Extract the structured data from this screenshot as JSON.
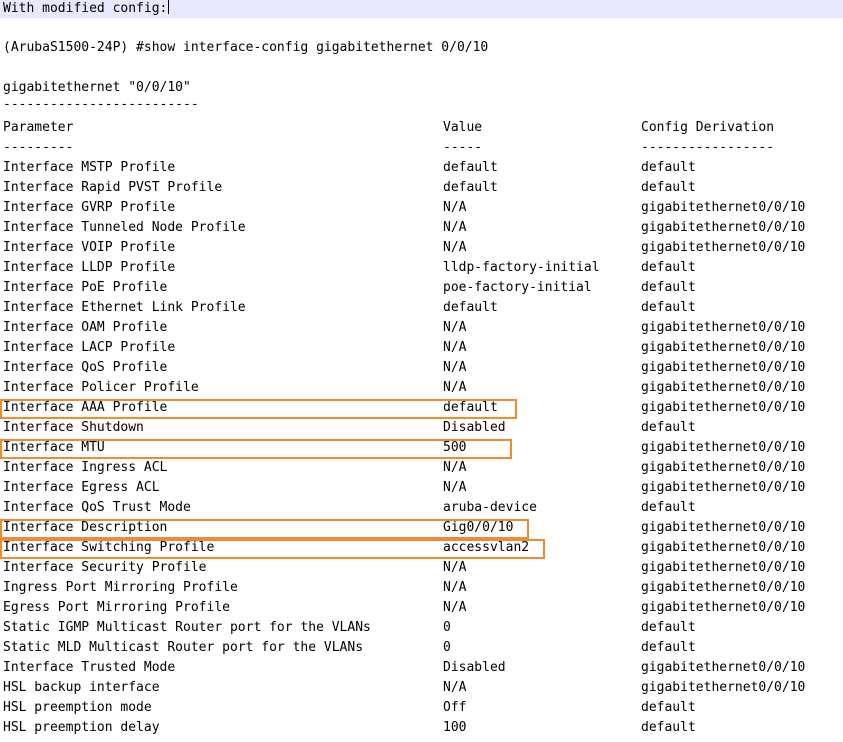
{
  "intro": {
    "title": "With modified config:",
    "command": "(ArubaS1500-24P) #show interface-config gigabitethernet 0/0/10",
    "section": "gigabitethernet \"0/0/10\"",
    "section_rule": "-------------------------"
  },
  "table": {
    "headers": [
      "Parameter",
      "Value",
      "Config Derivation"
    ],
    "rules": [
      "---------",
      "-----",
      "-----------------"
    ],
    "rows": [
      [
        "Interface MSTP Profile",
        "default",
        "default"
      ],
      [
        "Interface Rapid PVST Profile",
        "default",
        "default"
      ],
      [
        "Interface GVRP Profile",
        "N/A",
        "gigabitethernet0/0/10"
      ],
      [
        "Interface Tunneled Node Profile",
        "N/A",
        "gigabitethernet0/0/10"
      ],
      [
        "Interface VOIP Profile",
        "N/A",
        "gigabitethernet0/0/10"
      ],
      [
        "Interface LLDP Profile",
        "lldp-factory-initial",
        "default"
      ],
      [
        "Interface PoE Profile",
        "poe-factory-initial",
        "default"
      ],
      [
        "Interface Ethernet Link Profile",
        "default",
        "default"
      ],
      [
        "Interface OAM Profile",
        "N/A",
        "gigabitethernet0/0/10"
      ],
      [
        "Interface LACP Profile",
        "N/A",
        "gigabitethernet0/0/10"
      ],
      [
        "Interface QoS Profile",
        "N/A",
        "gigabitethernet0/0/10"
      ],
      [
        "Interface Policer Profile",
        "N/A",
        "gigabitethernet0/0/10"
      ],
      [
        "Interface AAA Profile",
        "default",
        "gigabitethernet0/0/10"
      ],
      [
        "Interface Shutdown",
        "Disabled",
        "default"
      ],
      [
        "Interface MTU",
        "500",
        "gigabitethernet0/0/10"
      ],
      [
        "Interface Ingress ACL",
        "N/A",
        "gigabitethernet0/0/10"
      ],
      [
        "Interface Egress ACL",
        "N/A",
        "gigabitethernet0/0/10"
      ],
      [
        "Interface QoS Trust Mode",
        "aruba-device",
        "default"
      ],
      [
        "Interface Description",
        "Gig0/0/10",
        "gigabitethernet0/0/10"
      ],
      [
        "Interface Switching Profile",
        "accessvlan2",
        "gigabitethernet0/0/10"
      ],
      [
        "Interface Security Profile",
        "N/A",
        "gigabitethernet0/0/10"
      ],
      [
        "Ingress Port Mirroring Profile",
        "N/A",
        "gigabitethernet0/0/10"
      ],
      [
        "Egress Port Mirroring Profile",
        "N/A",
        "gigabitethernet0/0/10"
      ],
      [
        "Static IGMP Multicast Router port for the VLANs",
        "0",
        "default"
      ],
      [
        "Static MLD Multicast Router port for the VLANs",
        "0",
        "default"
      ],
      [
        "Interface Trusted Mode",
        "Disabled",
        "gigabitethernet0/0/10"
      ],
      [
        "HSL backup interface",
        "N/A",
        "gigabitethernet0/0/10"
      ],
      [
        "HSL preemption mode",
        "Off",
        "default"
      ],
      [
        "HSL preemption delay",
        "100",
        "default"
      ]
    ]
  },
  "highlight_color": "#f08a33",
  "highlight_bg": "#e8e8ff"
}
